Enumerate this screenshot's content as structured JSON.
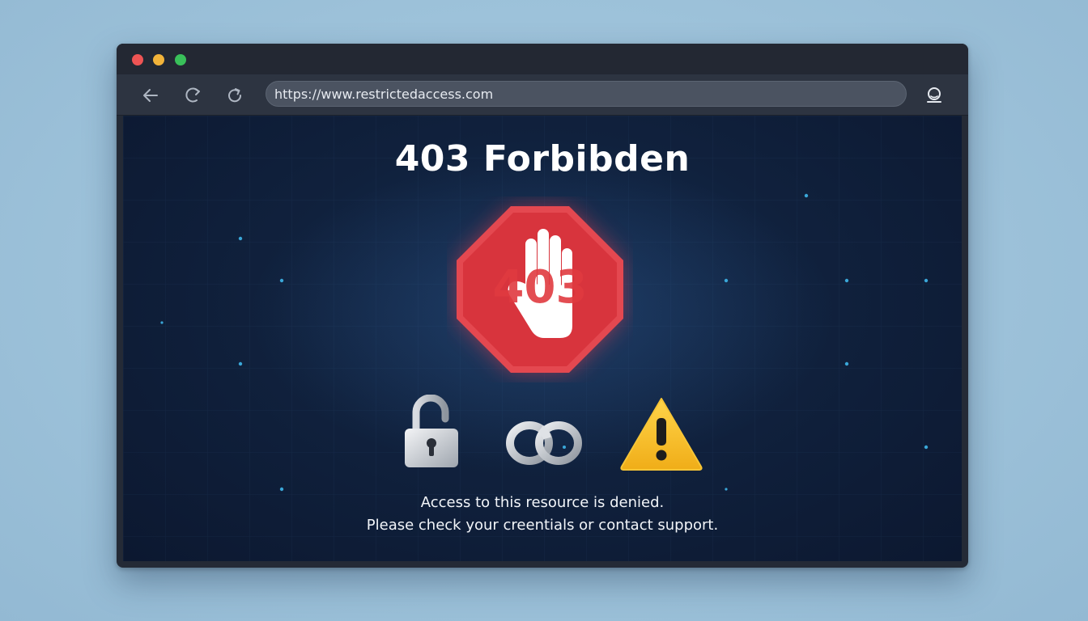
{
  "browser": {
    "url": "https://www.restrictedaccess.com",
    "traffic_lights": {
      "close_color": "#ee5454",
      "minimize_color": "#f2b33a",
      "maximize_color": "#39c05a"
    },
    "icons": {
      "back": "arrow-left-icon",
      "forward": "arrow-forward-icon",
      "reload": "reload-icon",
      "profile": "profile-icon"
    }
  },
  "page": {
    "title": "403 Forbibden",
    "badge_code": "403",
    "message_line_1": "Access to this resource is denied.",
    "message_line_2": "Please check your creentials or contact support.",
    "colors": {
      "stop_sign_red": "#e03a40",
      "warning_yellow": "#f6c12b",
      "background_navy": "#10213d"
    },
    "icons": [
      "stop-hand-icon",
      "lock-icon",
      "chain-link-icon",
      "warning-icon"
    ]
  }
}
